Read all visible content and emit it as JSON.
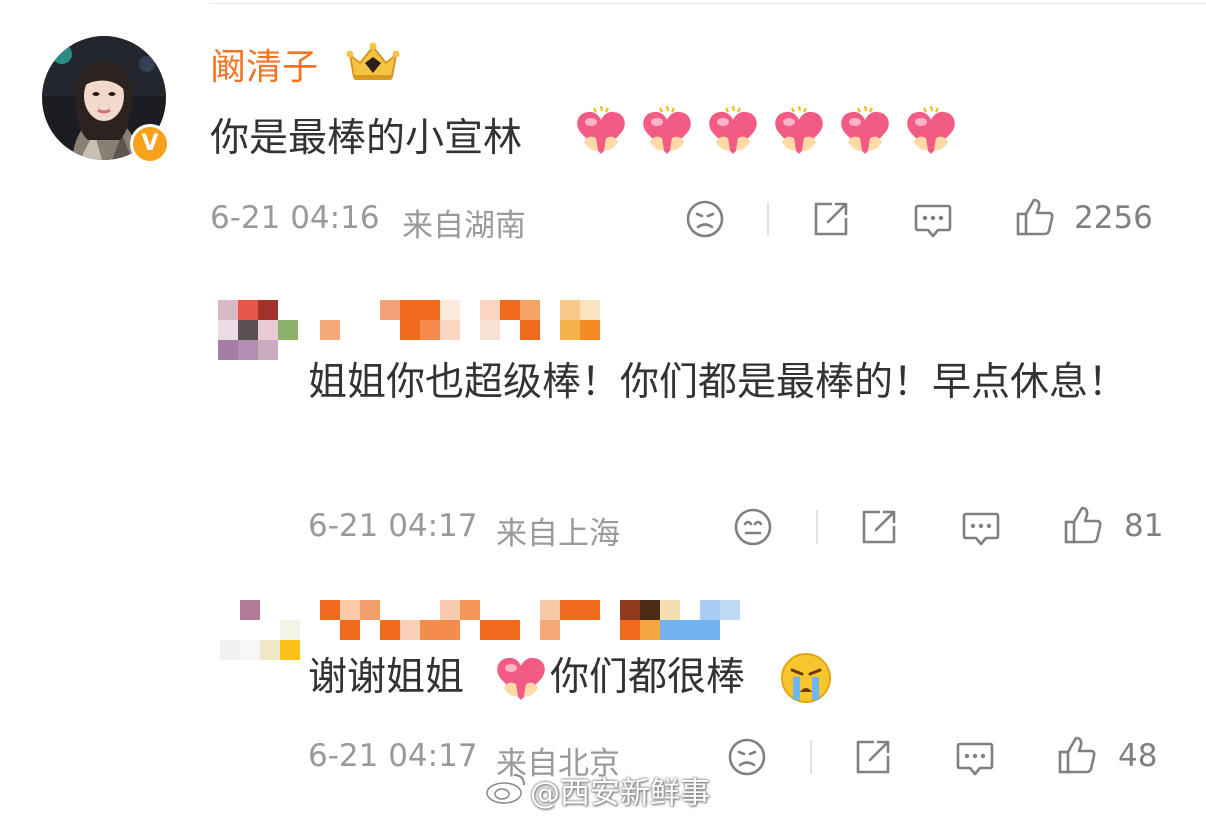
{
  "main_comment": {
    "author": "阚清子",
    "text": "你是最棒的小宣林",
    "hearts": 6,
    "time": "6-21 04:16",
    "location": "来自湖南",
    "likes": "2256"
  },
  "replies": [
    {
      "text": "姐姐你也超级棒！你们都是最棒的！早点休息！",
      "time": "6-21 04:17",
      "location": "来自上海",
      "likes": "81"
    },
    {
      "text_before": "谢谢姐姐",
      "text_after": "你们都很棒",
      "time": "6-21 04:17",
      "location": "来自北京",
      "likes": "48"
    }
  ],
  "watermark": "@西安新鲜事",
  "colors": {
    "author_orange": "#f27424",
    "meta_gray": "#9a9a9a",
    "badge_orange": "#f7a21a",
    "heart_pink": "#f25c84"
  },
  "icons": [
    "face-icon",
    "share-icon",
    "comment-icon",
    "like-icon",
    "heart-emoji",
    "crying-emoji",
    "crown-icon",
    "verified-badge-icon",
    "weibo-logo-icon"
  ]
}
